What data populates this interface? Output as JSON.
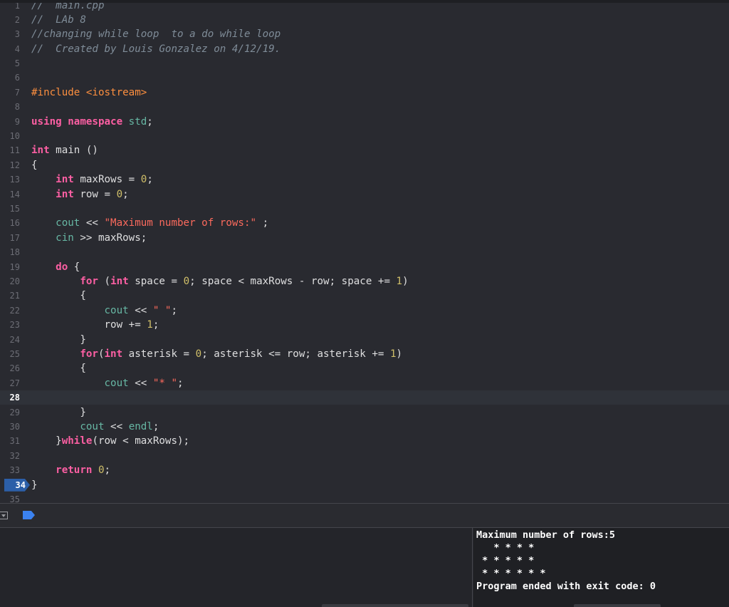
{
  "editor": {
    "lines": [
      {
        "n": "1",
        "segs": [
          {
            "c": "cm",
            "t": "//  main.cpp"
          }
        ]
      },
      {
        "n": "2",
        "segs": [
          {
            "c": "cm",
            "t": "//  LAb 8"
          }
        ]
      },
      {
        "n": "3",
        "segs": [
          {
            "c": "cm",
            "t": "//changing while loop  to a do while loop"
          }
        ]
      },
      {
        "n": "4",
        "segs": [
          {
            "c": "cm",
            "t": "//  Created by Louis Gonzalez on 4/12/19."
          }
        ]
      },
      {
        "n": "5",
        "segs": []
      },
      {
        "n": "6",
        "segs": []
      },
      {
        "n": "7",
        "segs": [
          {
            "c": "pp",
            "t": "#include <iostream>"
          }
        ]
      },
      {
        "n": "8",
        "segs": []
      },
      {
        "n": "9",
        "segs": [
          {
            "c": "kw",
            "t": "using namespace "
          },
          {
            "c": "id",
            "t": "std"
          },
          {
            "c": "plain",
            "t": ";"
          }
        ]
      },
      {
        "n": "10",
        "segs": []
      },
      {
        "n": "11",
        "segs": [
          {
            "c": "kw",
            "t": "int "
          },
          {
            "c": "plain",
            "t": "main ()"
          }
        ]
      },
      {
        "n": "12",
        "segs": [
          {
            "c": "plain",
            "t": "{"
          }
        ]
      },
      {
        "n": "13",
        "segs": [
          {
            "c": "plain",
            "t": "    "
          },
          {
            "c": "kw",
            "t": "int "
          },
          {
            "c": "plain",
            "t": "maxRows = "
          },
          {
            "c": "num",
            "t": "0"
          },
          {
            "c": "plain",
            "t": ";"
          }
        ]
      },
      {
        "n": "14",
        "segs": [
          {
            "c": "plain",
            "t": "    "
          },
          {
            "c": "kw",
            "t": "int "
          },
          {
            "c": "plain",
            "t": "row = "
          },
          {
            "c": "num",
            "t": "0"
          },
          {
            "c": "plain",
            "t": ";"
          }
        ]
      },
      {
        "n": "15",
        "segs": []
      },
      {
        "n": "16",
        "segs": [
          {
            "c": "plain",
            "t": "    "
          },
          {
            "c": "id",
            "t": "cout"
          },
          {
            "c": "plain",
            "t": " << "
          },
          {
            "c": "str",
            "t": "\"Maximum number of rows:\""
          },
          {
            "c": "plain",
            "t": " ;"
          }
        ]
      },
      {
        "n": "17",
        "segs": [
          {
            "c": "plain",
            "t": "    "
          },
          {
            "c": "id",
            "t": "cin"
          },
          {
            "c": "plain",
            "t": " >> maxRows;"
          }
        ]
      },
      {
        "n": "18",
        "segs": []
      },
      {
        "n": "19",
        "segs": [
          {
            "c": "plain",
            "t": "    "
          },
          {
            "c": "kw",
            "t": "do"
          },
          {
            "c": "plain",
            "t": " {"
          }
        ]
      },
      {
        "n": "20",
        "segs": [
          {
            "c": "plain",
            "t": "        "
          },
          {
            "c": "kw",
            "t": "for"
          },
          {
            "c": "plain",
            "t": " ("
          },
          {
            "c": "kw",
            "t": "int"
          },
          {
            "c": "plain",
            "t": " space = "
          },
          {
            "c": "num",
            "t": "0"
          },
          {
            "c": "plain",
            "t": "; space < maxRows - row; space += "
          },
          {
            "c": "num",
            "t": "1"
          },
          {
            "c": "plain",
            "t": ")"
          }
        ]
      },
      {
        "n": "21",
        "segs": [
          {
            "c": "plain",
            "t": "        {"
          }
        ]
      },
      {
        "n": "22",
        "segs": [
          {
            "c": "plain",
            "t": "            "
          },
          {
            "c": "id",
            "t": "cout"
          },
          {
            "c": "plain",
            "t": " << "
          },
          {
            "c": "str",
            "t": "\" \""
          },
          {
            "c": "plain",
            "t": ";"
          }
        ]
      },
      {
        "n": "23",
        "segs": [
          {
            "c": "plain",
            "t": "            row += "
          },
          {
            "c": "num",
            "t": "1"
          },
          {
            "c": "plain",
            "t": ";"
          }
        ]
      },
      {
        "n": "24",
        "segs": [
          {
            "c": "plain",
            "t": "        }"
          }
        ]
      },
      {
        "n": "25",
        "segs": [
          {
            "c": "plain",
            "t": "        "
          },
          {
            "c": "kw",
            "t": "for"
          },
          {
            "c": "plain",
            "t": "("
          },
          {
            "c": "kw",
            "t": "int"
          },
          {
            "c": "plain",
            "t": " asterisk = "
          },
          {
            "c": "num",
            "t": "0"
          },
          {
            "c": "plain",
            "t": "; asterisk <= row; asterisk += "
          },
          {
            "c": "num",
            "t": "1"
          },
          {
            "c": "plain",
            "t": ")"
          }
        ]
      },
      {
        "n": "26",
        "segs": [
          {
            "c": "plain",
            "t": "        {"
          }
        ]
      },
      {
        "n": "27",
        "segs": [
          {
            "c": "plain",
            "t": "            "
          },
          {
            "c": "id",
            "t": "cout"
          },
          {
            "c": "plain",
            "t": " << "
          },
          {
            "c": "str",
            "t": "\"* \""
          },
          {
            "c": "plain",
            "t": ";"
          }
        ]
      },
      {
        "n": "28",
        "segs": [],
        "current": true
      },
      {
        "n": "29",
        "segs": [
          {
            "c": "plain",
            "t": "        }"
          }
        ]
      },
      {
        "n": "30",
        "segs": [
          {
            "c": "plain",
            "t": "        "
          },
          {
            "c": "id",
            "t": "cout"
          },
          {
            "c": "plain",
            "t": " << "
          },
          {
            "c": "id",
            "t": "endl"
          },
          {
            "c": "plain",
            "t": ";"
          }
        ]
      },
      {
        "n": "31",
        "segs": [
          {
            "c": "plain",
            "t": "    }"
          },
          {
            "c": "kw",
            "t": "while"
          },
          {
            "c": "plain",
            "t": "(row < maxRows);"
          }
        ]
      },
      {
        "n": "32",
        "segs": []
      },
      {
        "n": "33",
        "segs": [
          {
            "c": "plain",
            "t": "    "
          },
          {
            "c": "kw",
            "t": "return"
          },
          {
            "c": "plain",
            "t": " "
          },
          {
            "c": "num",
            "t": "0"
          },
          {
            "c": "plain",
            "t": ";"
          }
        ]
      },
      {
        "n": "34",
        "segs": [
          {
            "c": "plain",
            "t": "}"
          }
        ],
        "breakpoint": true
      },
      {
        "n": "35",
        "segs": []
      }
    ]
  },
  "debug_bar": {
    "toggle_icon": "hide-debug-area-icon",
    "continue_icon": "breakpoint-continue-icon"
  },
  "console": {
    "lines": [
      "Maximum number of rows:5",
      "   * * * *",
      " * * * * *",
      " * * * * * *",
      "Program ended with exit code: 0"
    ]
  }
}
